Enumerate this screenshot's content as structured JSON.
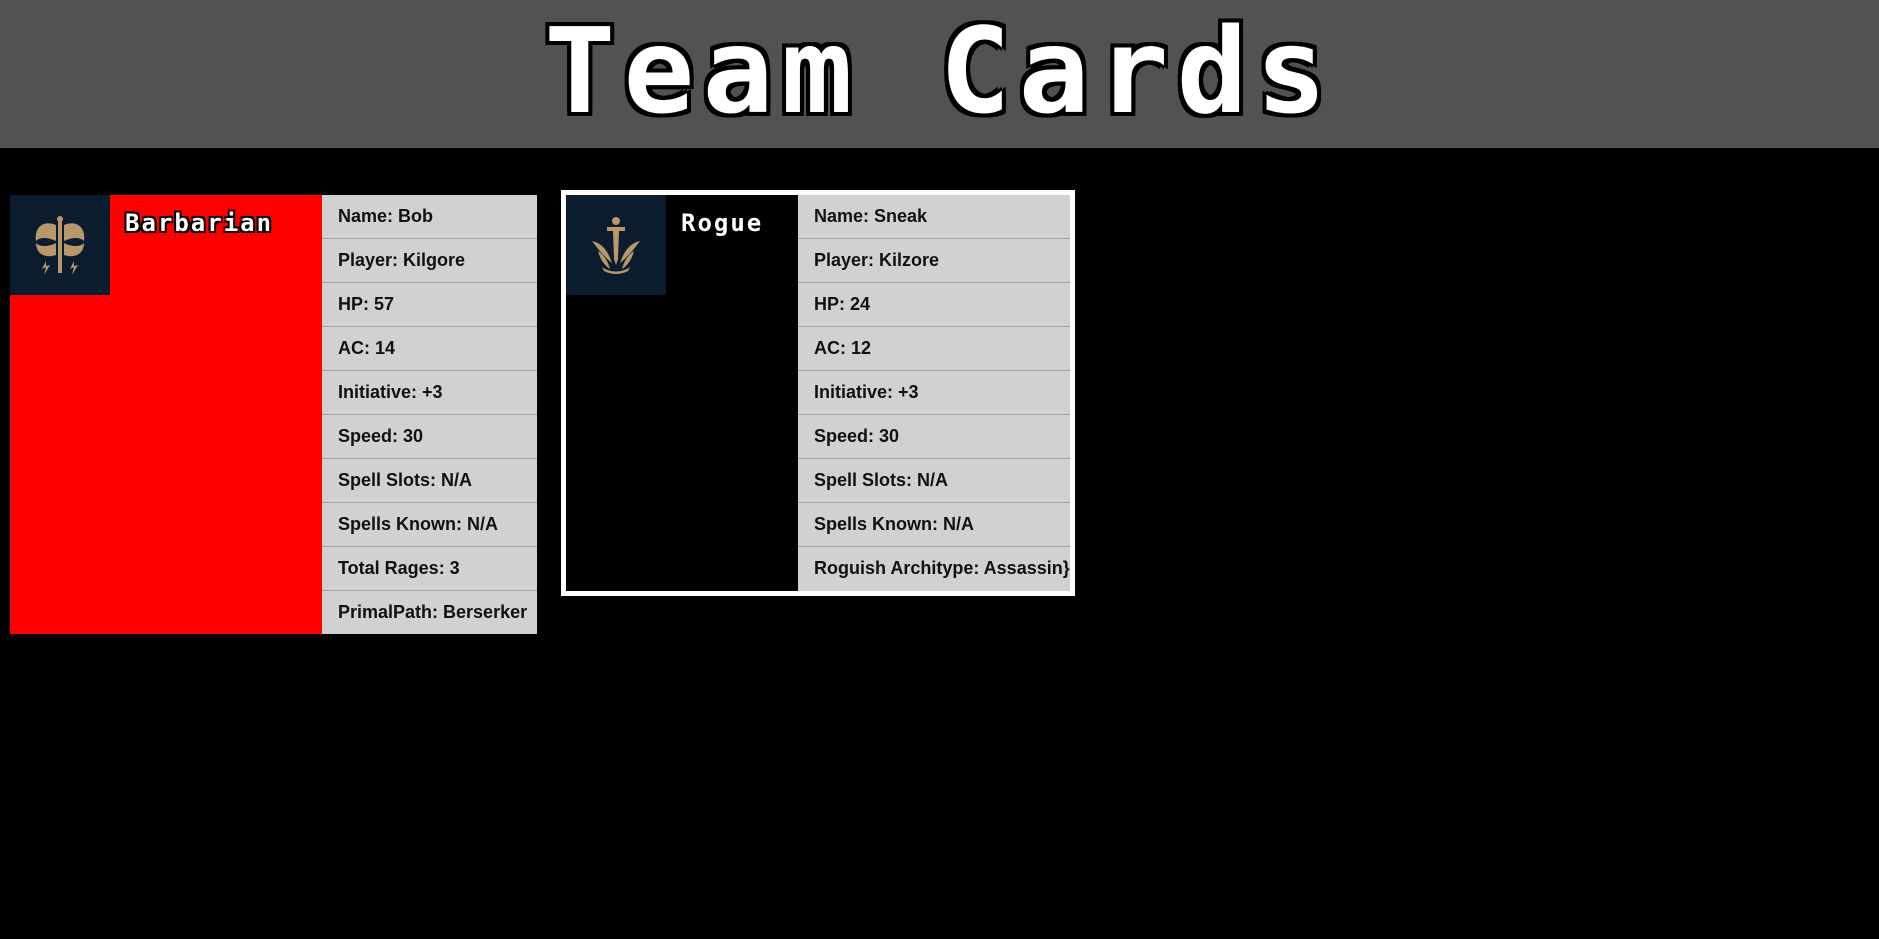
{
  "header": {
    "title": "Team Cards"
  },
  "colors": {
    "header_bg": "#525252",
    "page_bg": "#000000",
    "barbarian_bg": "#ff0000",
    "rogue_bg": "#000000",
    "icon_bg": "#0b1c2e",
    "icon_gold": "#b8976a",
    "stats_bg": "#d1d1d1"
  },
  "cards": [
    {
      "class_name": "Barbarian",
      "icon": "double-axe-icon",
      "stats": [
        "Name: Bob",
        "Player: Kilgore",
        "HP: 57",
        "AC: 14",
        "Initiative: +3",
        "Speed: 30",
        "Spell Slots: N/A",
        "Spells Known: N/A",
        "Total Rages: 3",
        "PrimalPath: Berserker"
      ]
    },
    {
      "class_name": "Rogue",
      "icon": "dagger-crest-icon",
      "stats": [
        "Name: Sneak",
        "Player: Kilzore",
        "HP: 24",
        "AC: 12",
        "Initiative: +3",
        "Speed: 30",
        "Spell Slots: N/A",
        "Spells Known: N/A",
        "Roguish Architype: Assassin}"
      ]
    }
  ]
}
